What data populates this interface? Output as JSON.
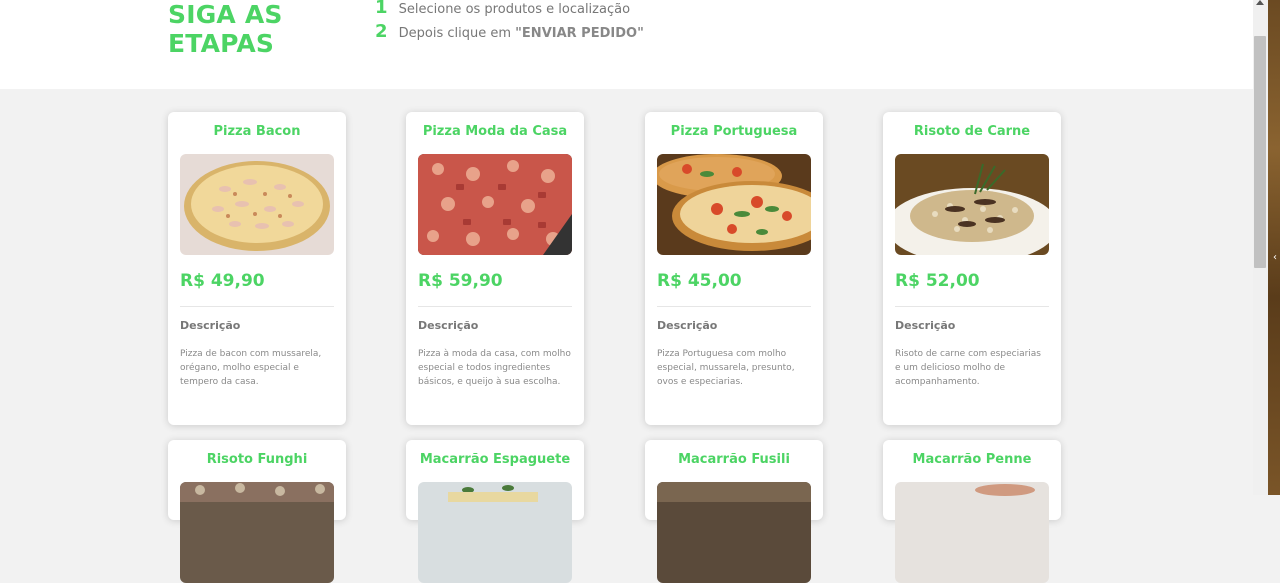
{
  "header": {
    "title_line1": "SIGA AS",
    "title_line2": "ETAPAS",
    "steps": [
      {
        "num": "1",
        "text": "Selecione os produtos e localização"
      },
      {
        "num": "2",
        "text_before": "Depois clique em ",
        "text_bold": "\"ENVIAR PEDIDO\""
      }
    ]
  },
  "products": [
    {
      "name": "Pizza Bacon",
      "price": "R$ 49,90",
      "desc_label": "Descrição",
      "desc": "Pizza de bacon com mussarela, orégano, molho especial e tempero da casa."
    },
    {
      "name": "Pizza Moda da Casa",
      "price": "R$ 59,90",
      "desc_label": "Descrição",
      "desc": "Pizza à moda da casa, com molho especial e todos ingredientes básicos, e queijo à sua escolha."
    },
    {
      "name": "Pizza Portuguesa",
      "price": "R$ 45,00",
      "desc_label": "Descrição",
      "desc": "Pizza Portuguesa com molho especial, mussarela, presunto, ovos e especiarias."
    },
    {
      "name": "Risoto de Carne",
      "price": "R$ 52,00",
      "desc_label": "Descrição",
      "desc": "Risoto de carne com especiarias e um delicioso molho de acompanhamento."
    },
    {
      "name": "Risoto Funghi"
    },
    {
      "name": "Macarrão Espaguete"
    },
    {
      "name": "Macarrão Fusili"
    },
    {
      "name": "Macarrão Penne"
    }
  ],
  "colors": {
    "accent": "#4cd464",
    "text_muted": "#777777",
    "page_bg": "#f2f2f2"
  }
}
